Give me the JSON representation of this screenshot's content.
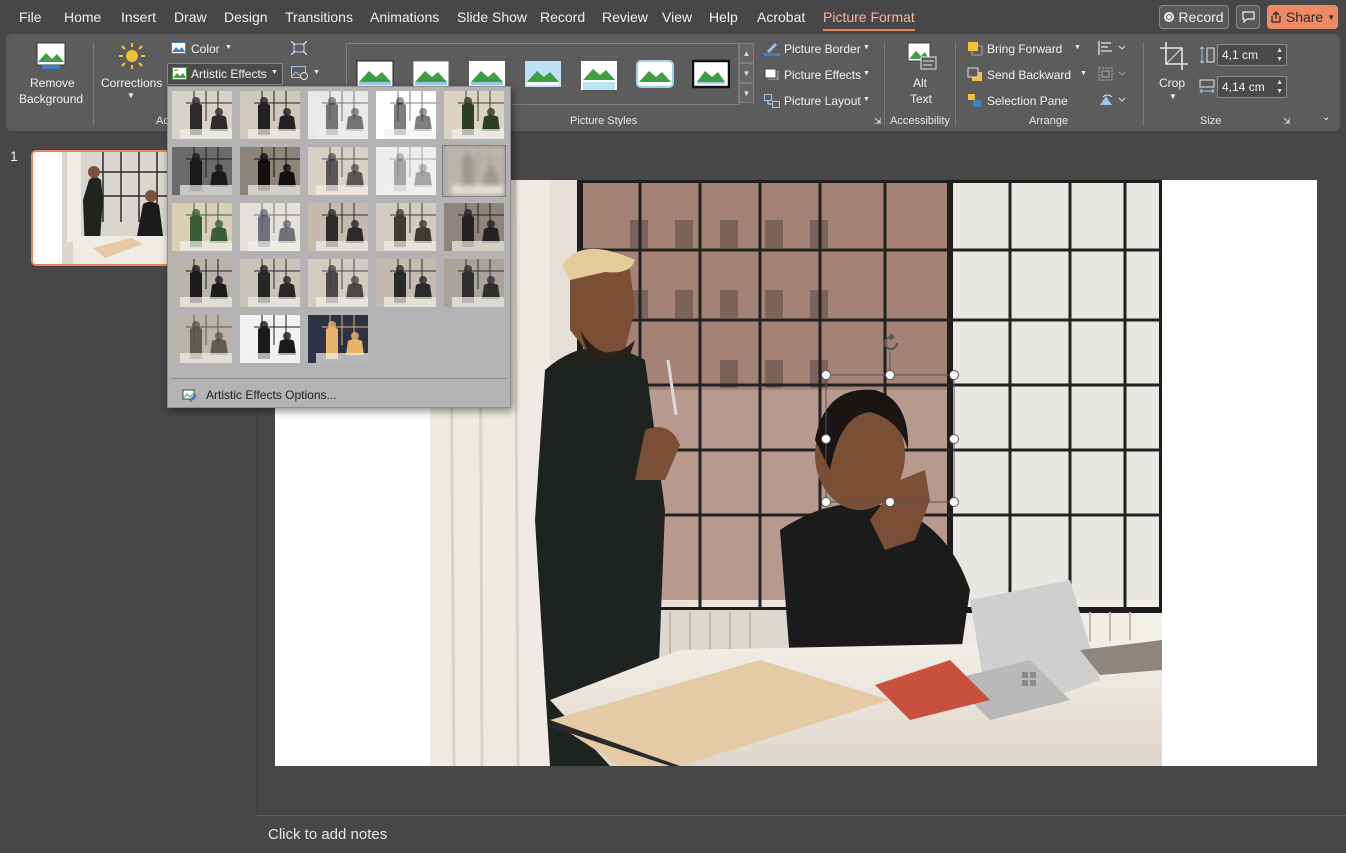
{
  "menubar": {
    "tabs": [
      {
        "label": "File"
      },
      {
        "label": "Home"
      },
      {
        "label": "Insert"
      },
      {
        "label": "Draw"
      },
      {
        "label": "Design"
      },
      {
        "label": "Transitions"
      },
      {
        "label": "Animations"
      },
      {
        "label": "Slide Show"
      },
      {
        "label": "Record"
      },
      {
        "label": "Review"
      },
      {
        "label": "View"
      },
      {
        "label": "Help"
      },
      {
        "label": "Acrobat"
      },
      {
        "label": "Picture Format"
      }
    ],
    "active_tab": "Picture Format",
    "record_label": "Record",
    "share_label": "Share"
  },
  "ribbon": {
    "remove_background": {
      "line1": "Remove",
      "line2": "Background"
    },
    "corrections_label": "Corrections",
    "color_label": "Color",
    "artistic_effects_label": "Artistic Effects",
    "adjust_group_label_partial": "Ac",
    "picture_styles_label": "Picture Styles",
    "picture_border_label": "Picture Border",
    "picture_effects_label": "Picture Effects",
    "picture_layout_label": "Picture Layout",
    "alt_text": {
      "line1": "Alt",
      "line2": "Text"
    },
    "accessibility_label": "Accessibility",
    "bring_forward_label": "Bring Forward",
    "send_backward_label": "Send Backward",
    "selection_pane_label": "Selection Pane",
    "arrange_label": "Arrange",
    "crop_label": "Crop",
    "height_value": "4,1 cm",
    "width_value": "4,14 cm",
    "size_label": "Size"
  },
  "artistic_effects_menu": {
    "options_label": "Artistic Effects Options...",
    "effect_count": 23,
    "selected_index": 9
  },
  "slides": {
    "current_number": "1"
  },
  "notes": {
    "placeholder": "Click to add notes"
  },
  "colors": {
    "accent": "#e8835e",
    "share_button": "#ec8a66",
    "background": "#474747",
    "ribbon": "#5c5c5c",
    "menu": "#b3b3b3"
  }
}
